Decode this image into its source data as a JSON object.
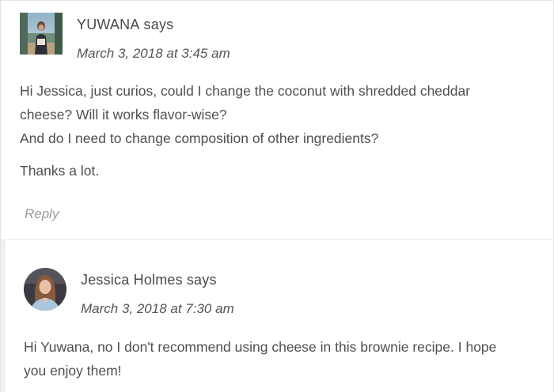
{
  "comments": [
    {
      "author": "YUWANA",
      "says": "says",
      "date": "March 3, 2018 at 3:45 am",
      "lines": [
        "Hi Jessica, just curios, could I change the coconut with shredded cheddar",
        "cheese? Will it works flavor-wise?",
        "And do I need to change composition of other ingredients?"
      ],
      "closing": "Thanks a lot.",
      "reply_label": "Reply"
    },
    {
      "author": "Jessica Holmes",
      "says": "says",
      "date": "March 3, 2018 at 7:30 am",
      "lines": [
        "Hi Yuwana, no I don't recommend using cheese in this brownie recipe. I hope",
        "you enjoy them!"
      ]
    }
  ],
  "colors": {
    "text": "#4f4f4f",
    "muted": "#9a9a9a",
    "divider": "#e6e6e6"
  },
  "icons": {
    "avatar_1": "user-photo-beach",
    "avatar_2": "user-photo-portrait"
  }
}
